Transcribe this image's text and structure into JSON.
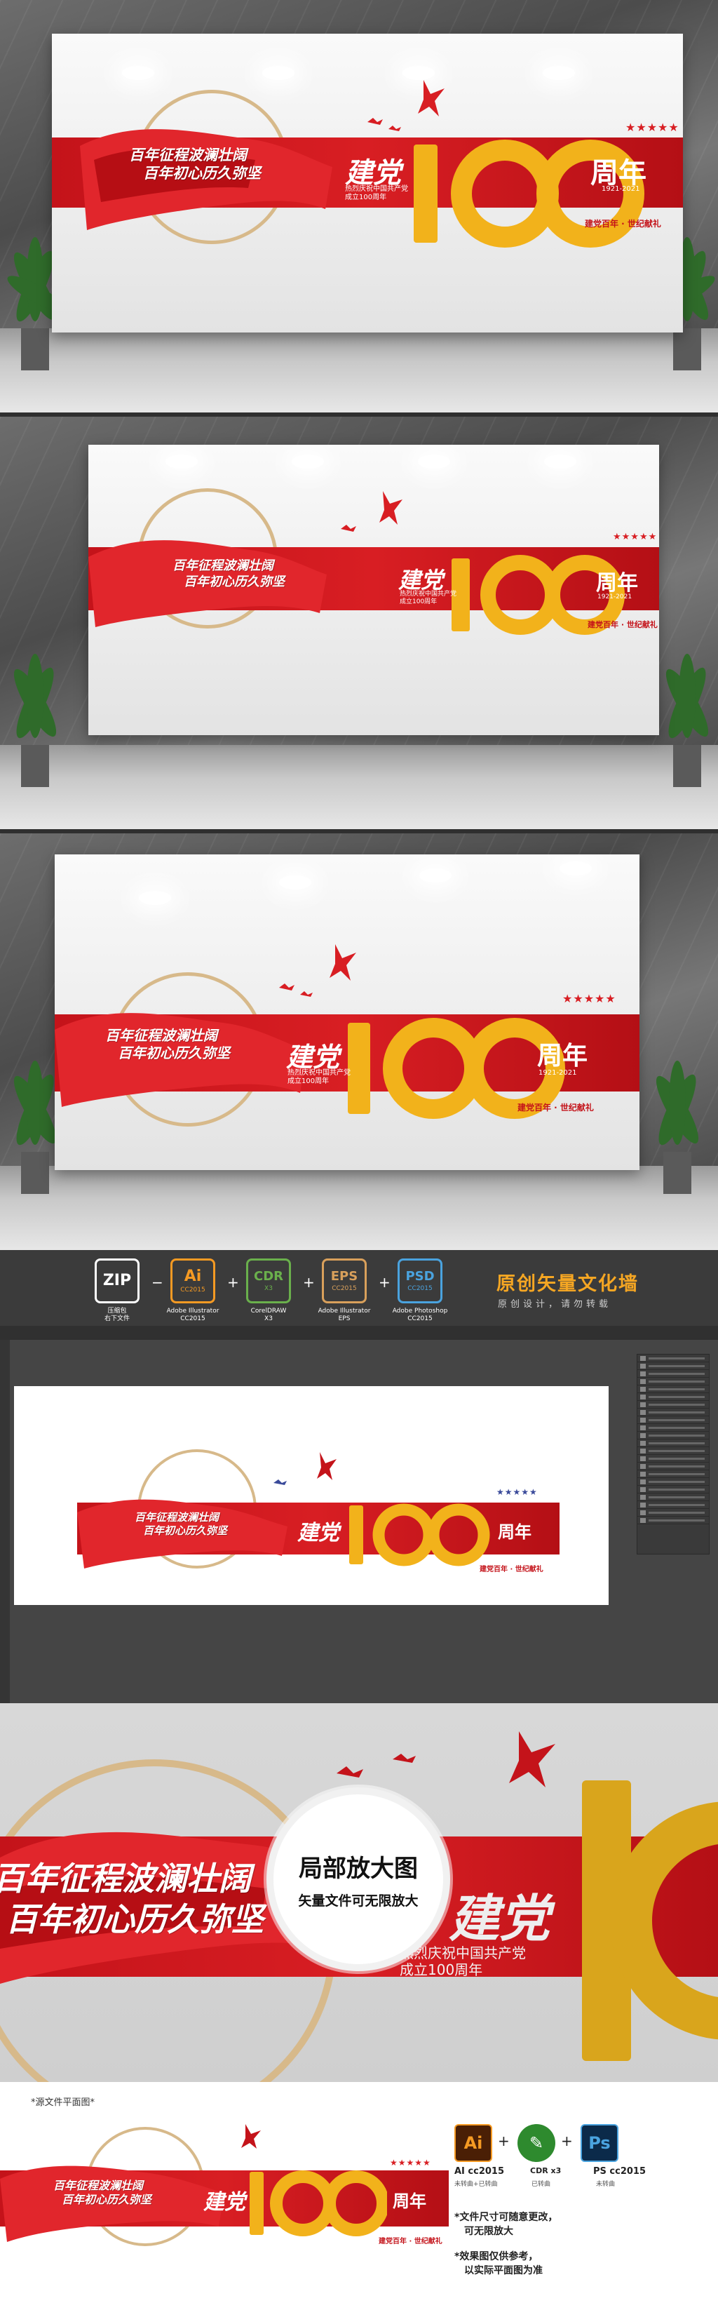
{
  "design": {
    "slogan_line1": "百年征程波澜壮阔",
    "slogan_line2": "百年初心历久弥坚",
    "jiandang": "建党",
    "number": "100",
    "zhounian": "周年",
    "tagline_line1": "热烈庆祝中国共产党",
    "tagline_line2": "成立100周年",
    "years": "1921-2021",
    "stars": "★★★★★",
    "footer": "建党百年 · 世纪献礼"
  },
  "formats": {
    "items": [
      {
        "icon": "ZIP",
        "sub": "",
        "caption": "压缩包\n右下文件",
        "color": "#ffffff"
      },
      {
        "icon": "Ai",
        "sub": "CC2015",
        "caption": "Adobe Illustrator\nCC2015",
        "color": "#f59a23"
      },
      {
        "icon": "CDR",
        "sub": "X3",
        "caption": "CorelDRAW\nX3",
        "color": "#6ab04c"
      },
      {
        "icon": "EPS",
        "sub": "CC2015",
        "caption": "Adobe Illustrator\nEPS",
        "color": "#d9a05b"
      },
      {
        "icon": "PSD",
        "sub": "CC2015",
        "caption": "Adobe Photoshop\nCC2015",
        "color": "#4aa3df"
      }
    ],
    "title": "原创矢量文化墙",
    "subtitle": "原创设计，请勿转载"
  },
  "zoom": {
    "title": "局部放大图",
    "subtitle": "矢量文件可无限放大"
  },
  "source": {
    "label": "*源文件平面图*",
    "ai_label": "AI cc2015",
    "ai_sub": "未转曲+已转曲",
    "cdr_label": "CDR x3",
    "cdr_sub": "已转曲",
    "ps_label": "PS cc2015",
    "ps_sub": "未转曲",
    "note1_line1": "*文件尺寸可随意更改，",
    "note1_line2": "可无限放大",
    "note2_line1": "*效果图仅供参考，",
    "note2_line2": "以实际平面图为准"
  },
  "colors": {
    "party_red": "#d81e23",
    "gold": "#f2b21b",
    "accent_orange": "#f5a623"
  }
}
